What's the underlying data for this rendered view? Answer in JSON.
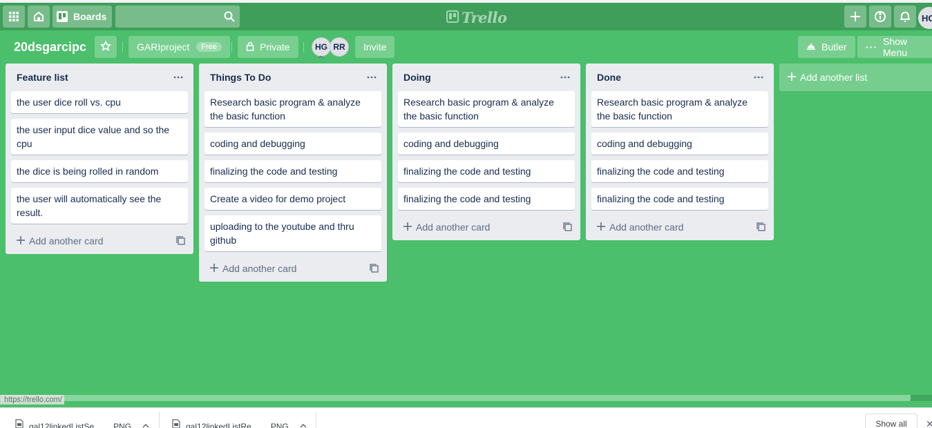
{
  "header": {
    "apps_icon": "apps-grid-icon",
    "home_icon": "home-icon",
    "boards_label": "Boards",
    "search_placeholder": "",
    "logo_text": "Trello",
    "user_initials": "HG"
  },
  "board": {
    "title": "20dsgarcipc",
    "team_name": "GARIproject",
    "team_badge": "Free",
    "visibility": "Private",
    "members": [
      "HG",
      "RR"
    ],
    "invite_label": "Invite",
    "butler_label": "Butler",
    "show_menu_label": "Show Menu"
  },
  "lists": [
    {
      "title": "Feature list",
      "cards": [
        "the user dice roll vs. cpu",
        "the user input dice value and so the cpu",
        "the dice is being rolled in random",
        "the user will automatically see the result."
      ],
      "add_card_label": "Add another card"
    },
    {
      "title": "Things To Do",
      "cards": [
        "Research basic program & analyze the basic function",
        "coding and debugging",
        "finalizing the code and testing",
        "Create a video for demo project",
        "uploading to the youtube and thru github"
      ],
      "add_card_label": "Add another card"
    },
    {
      "title": "Doing",
      "cards": [
        "Research basic program & analyze the basic function",
        "coding and debugging",
        "finalizing the code and testing",
        "finalizing the code and testing"
      ],
      "add_card_label": "Add another card"
    },
    {
      "title": "Done",
      "cards": [
        "Research basic program & analyze the basic function",
        "coding and debugging",
        "finalizing the code and testing",
        "finalizing the code and testing"
      ],
      "add_card_label": "Add another card"
    }
  ],
  "add_list_label": "Add another list",
  "status_url": "https://trello.com/",
  "downloads": {
    "items": [
      {
        "name": "gal12linkedListSe...",
        "type": "PNG"
      },
      {
        "name": "gal12linkedListRe...",
        "type": "PNG"
      }
    ],
    "show_all_label": "Show all",
    "close_label": "✕"
  },
  "colors": {
    "board_bg": "#4bbf6b",
    "header_bg": "#3f9f5a",
    "list_bg": "#ebecf0",
    "card_bg": "#ffffff"
  }
}
